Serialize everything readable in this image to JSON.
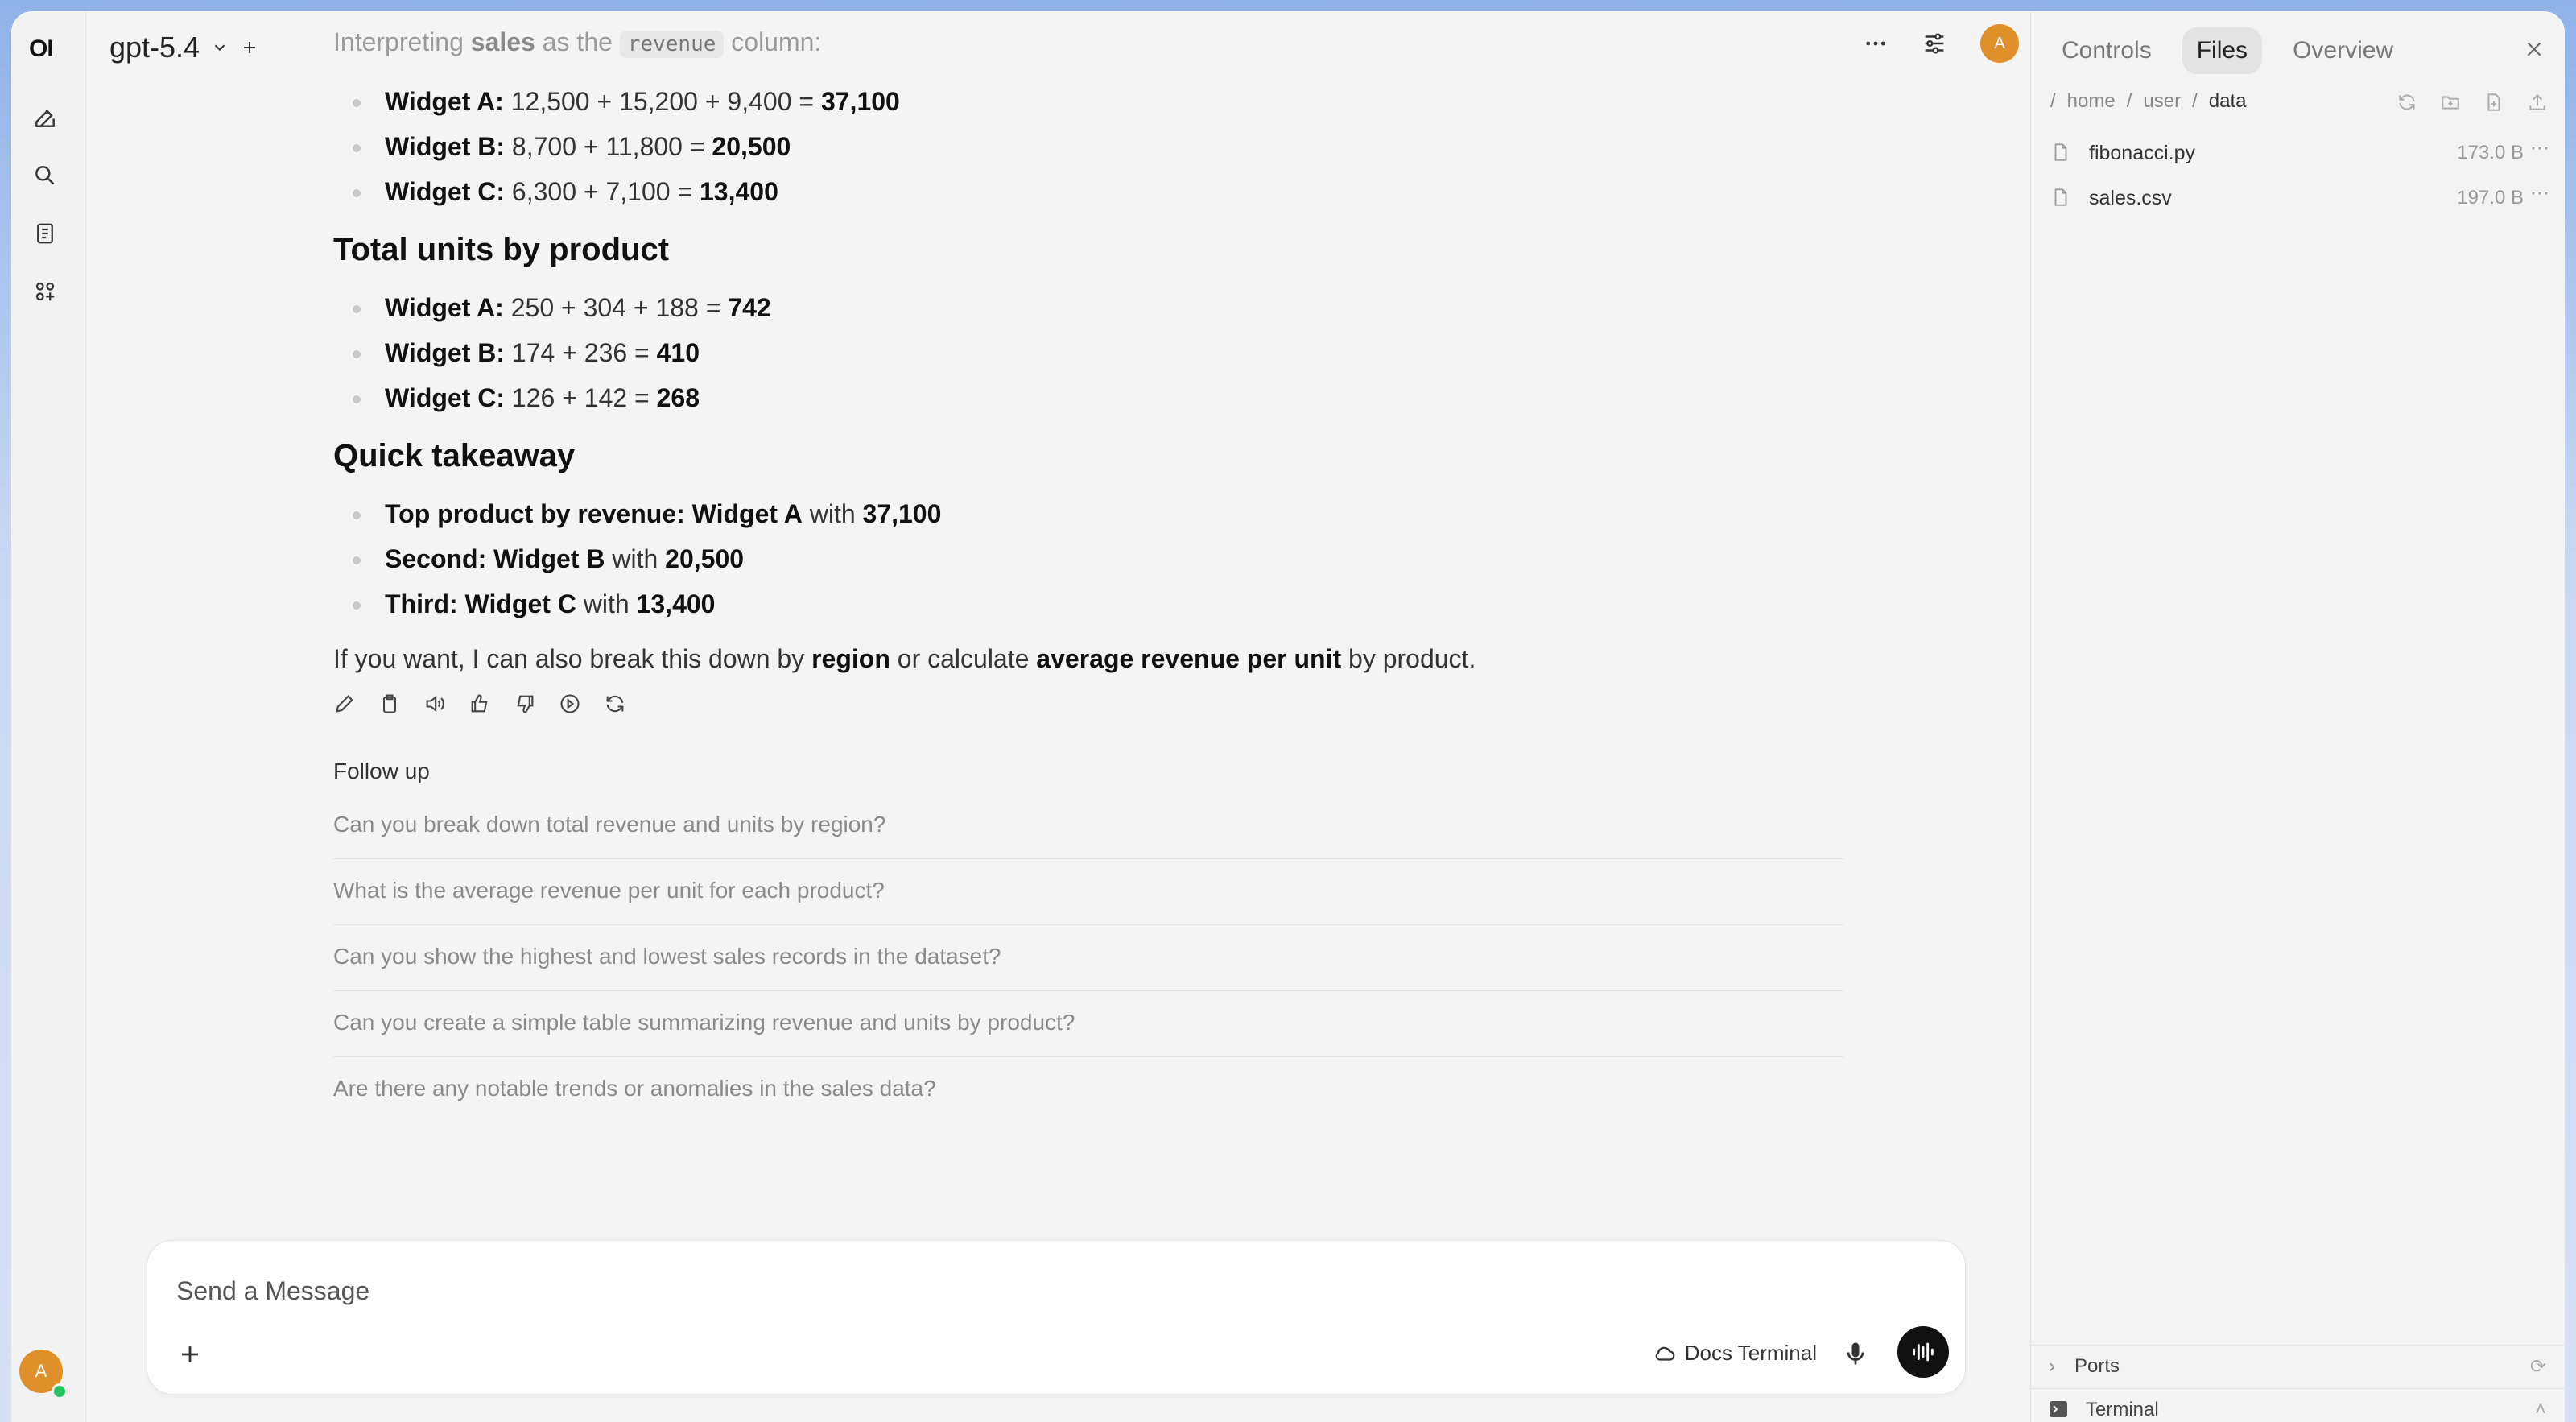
{
  "rail": {
    "logo": "OI",
    "avatar": "A"
  },
  "header": {
    "model": "gpt-5.4",
    "avatar": "A"
  },
  "chat": {
    "intro": {
      "prefix": "Interpreting ",
      "bold": "sales",
      "middle": " as the ",
      "code": "revenue",
      "suffix": " column:"
    },
    "revenue_items": [
      {
        "label": "Widget A:",
        "expr": " 12,500 + 15,200 + 9,400 = ",
        "total": "37,100"
      },
      {
        "label": "Widget B:",
        "expr": " 8,700 + 11,800 = ",
        "total": "20,500"
      },
      {
        "label": "Widget C:",
        "expr": " 6,300 + 7,100 = ",
        "total": "13,400"
      }
    ],
    "units_heading": "Total units by product",
    "units_items": [
      {
        "label": "Widget A:",
        "expr": " 250 + 304 + 188 = ",
        "total": "742"
      },
      {
        "label": "Widget B:",
        "expr": " 174 + 236 = ",
        "total": "410"
      },
      {
        "label": "Widget C:",
        "expr": " 126 + 142 = ",
        "total": "268"
      }
    ],
    "takeaway_heading": "Quick takeaway",
    "takeaway_items": [
      {
        "bold": "Top product by revenue: Widget A",
        "mid": " with ",
        "val": "37,100"
      },
      {
        "bold": "Second: Widget B",
        "mid": " with ",
        "val": "20,500"
      },
      {
        "bold": "Third: Widget C",
        "mid": " with ",
        "val": "13,400"
      }
    ],
    "closing": {
      "a": "If you want, I can also break this down by ",
      "b": "region",
      "c": " or calculate ",
      "d": "average revenue per unit",
      "e": " by product."
    },
    "follow_up_heading": "Follow up",
    "follow_ups": [
      "Can you break down total revenue and units by region?",
      "What is the average revenue per unit for each product?",
      "Can you show the highest and lowest sales records in the dataset?",
      "Can you create a simple table summarizing revenue and units by product?",
      "Are there any notable trends or anomalies in the sales data?"
    ]
  },
  "composer": {
    "placeholder": "Send a Message",
    "docs_label": "Docs Terminal"
  },
  "panel": {
    "tabs": [
      "Controls",
      "Files",
      "Overview"
    ],
    "breadcrumb": [
      "home",
      "user",
      "data"
    ],
    "files": [
      {
        "name": "fibonacci.py",
        "size": "173.0 B"
      },
      {
        "name": "sales.csv",
        "size": "197.0 B"
      }
    ],
    "ports_label": "Ports",
    "terminal_label": "Terminal"
  }
}
